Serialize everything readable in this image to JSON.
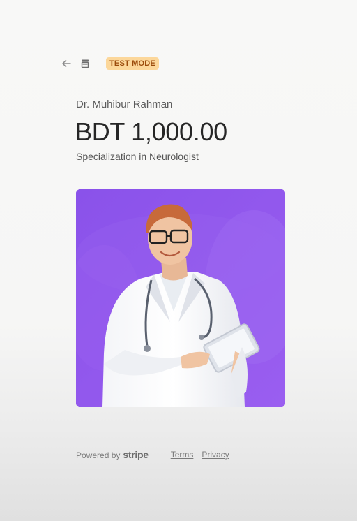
{
  "header": {
    "back_icon": "arrow-left-icon",
    "store_icon": "storefront-icon",
    "badge": "TEST MODE"
  },
  "product": {
    "merchant_name": "Dr. Muhibur Rahman",
    "amount": "BDT 1,000.00",
    "description": "Specialization in Neurologist",
    "image": "doctor-holding-tablet-photo"
  },
  "footer": {
    "powered_by": "Powered by",
    "brand": "stripe",
    "terms": "Terms",
    "privacy": "Privacy"
  },
  "colors": {
    "badge_bg": "#fcd79a",
    "badge_text": "#9b4b0b",
    "image_bg": "#8f56ec"
  }
}
